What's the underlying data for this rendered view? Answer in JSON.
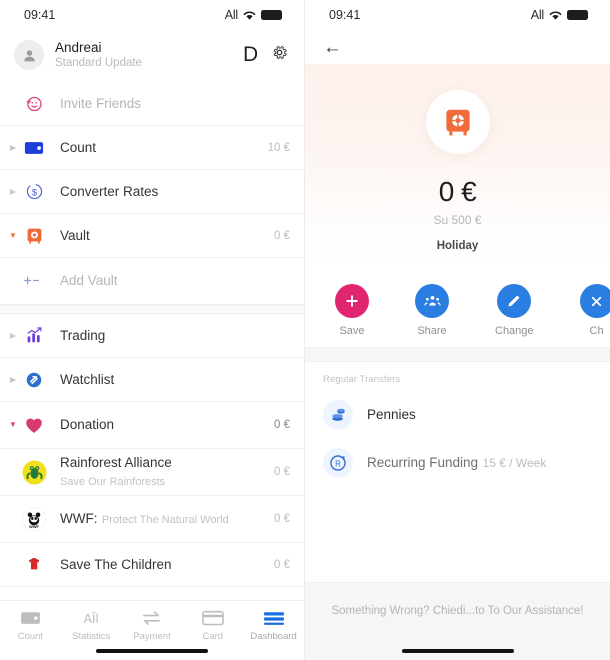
{
  "status_bar": {
    "time": "09:41",
    "carrier": "All",
    "wifi_icon": "wifi-icon",
    "battery_icon": "battery-icon"
  },
  "left_panel": {
    "account": {
      "name": "Andreai",
      "subtitle": "Standard Update",
      "avatar_icon": "person-icon",
      "letter_badge": "D",
      "settings_icon": "gear-icon"
    },
    "rows": [
      {
        "title": "Invite Friends",
        "sub": "",
        "amount": "",
        "icon": "invite-friends-icon",
        "caret": "",
        "muted": true
      },
      {
        "title": "Count",
        "sub": "",
        "amount": "10 €",
        "icon": "wallet-icon",
        "caret": "right",
        "muted": false
      },
      {
        "title": "Converter Rates",
        "sub": "",
        "amount": "",
        "icon": "currency-exchange-icon",
        "caret": "right",
        "muted": false
      },
      {
        "title": "Vault",
        "sub": "",
        "amount": "0 €",
        "icon": "safe-icon",
        "caret": "down-orange",
        "muted": false
      },
      {
        "title": "Add Vault",
        "sub": "",
        "amount": "",
        "icon": "plus-minus-icon",
        "caret": "",
        "muted": true
      },
      {
        "title": "Trading",
        "sub": "",
        "amount": "",
        "icon": "bar-chart-icon",
        "caret": "right",
        "muted": false
      },
      {
        "title": "Watchlist",
        "sub": "",
        "amount": "",
        "icon": "refresh-circle-icon",
        "caret": "right",
        "muted": false
      },
      {
        "title": "Donation",
        "sub": "",
        "amount": "0 €",
        "icon": "heart-icon",
        "caret": "down-pink",
        "muted": false
      },
      {
        "title": "Rainforest Alliance",
        "sub": "Save Our Rainforests",
        "amount": "0 €",
        "icon": "frog-icon",
        "caret": "",
        "muted": false
      },
      {
        "title": "WWF:",
        "sub": "Protect The Natural World",
        "amount": "0 €",
        "icon": "panda-icon",
        "caret": "",
        "muted": false
      },
      {
        "title": "Save The Children",
        "sub": "",
        "amount": "0 €",
        "icon": "children-icon",
        "caret": "",
        "muted": false
      }
    ],
    "tabs": [
      {
        "label": "Count",
        "icon": "wallet-outline-icon",
        "active": false
      },
      {
        "label": "Statistics",
        "icon": "statistics-icon",
        "active": false
      },
      {
        "label": "Payment",
        "icon": "transfer-arrows-icon",
        "active": false
      },
      {
        "label": "Card",
        "icon": "card-icon",
        "active": false
      },
      {
        "label": "Dashboard",
        "icon": "dashboard-icon",
        "active": true
      }
    ]
  },
  "right_panel": {
    "back_icon": "back-arrow-icon",
    "hero": {
      "icon": "safe-icon",
      "amount": "0 €",
      "goal": "Su 500 €",
      "tag": "Holiday"
    },
    "actions": [
      {
        "label": "Save",
        "icon": "plus-icon",
        "color": "#e0266f"
      },
      {
        "label": "Share",
        "icon": "group-people-icon",
        "color": "#2a7de1"
      },
      {
        "label": "Change",
        "icon": "pencil-icon",
        "color": "#2a7de1"
      },
      {
        "label": "Ch",
        "icon": "close-icon",
        "color": "#2a7de1"
      }
    ],
    "section_title": "Regular Transfers",
    "transfers": [
      {
        "title": "Pennies",
        "sub": "",
        "icon": "coins-icon"
      },
      {
        "title": "Recurring Funding",
        "sub": "15 € / Week",
        "icon": "recurring-icon"
      }
    ],
    "assistance": "Something Wrong? Chiedi...to To Our Assistance!"
  }
}
